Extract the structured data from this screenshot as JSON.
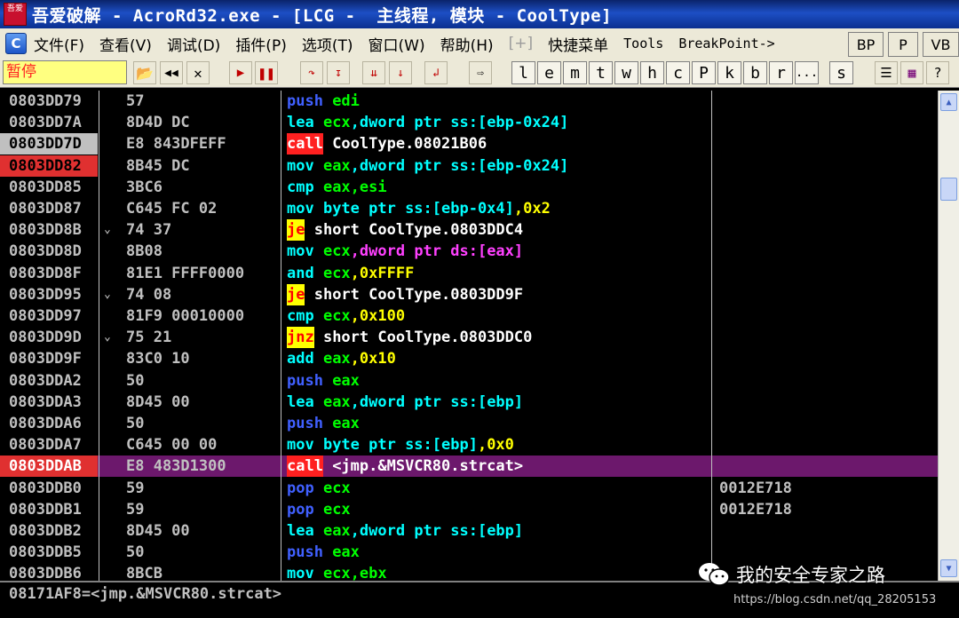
{
  "window": {
    "title": "吾爱破解 - AcroRd32.exe - [LCG -  主线程, 模块 - CoolType]",
    "icon_text": "吾爱"
  },
  "menu": {
    "items": [
      {
        "label": "文件(F)"
      },
      {
        "label": "查看(V)"
      },
      {
        "label": "调试(D)"
      },
      {
        "label": "插件(P)"
      },
      {
        "label": "选项(T)"
      },
      {
        "label": "窗口(W)"
      },
      {
        "label": "帮助(H)"
      },
      {
        "label": "[+]",
        "disabled": true
      },
      {
        "label": "快捷菜单"
      },
      {
        "label": "Tools",
        "mono": true
      },
      {
        "label": "BreakPoint->",
        "mono": true
      }
    ],
    "right_buttons": [
      "BP",
      "P",
      "VB"
    ]
  },
  "toolbar": {
    "status": "暂停",
    "letters": [
      "l",
      "e",
      "m",
      "t",
      "w",
      "h",
      "c",
      "P",
      "k",
      "b",
      "r",
      "...",
      "s"
    ]
  },
  "disasm": {
    "rows": [
      {
        "addr": "0803DD79",
        "mark": "",
        "hex": "57",
        "mnem": "push",
        "ops": [
          {
            "t": " edi",
            "c": "#00ff00"
          }
        ],
        "comment": ""
      },
      {
        "addr": "0803DD7A",
        "mark": "",
        "hex": "8D4D DC",
        "mnem": "lea",
        "ops": [
          {
            "t": " ecx",
            "c": "#00ff00"
          },
          {
            "t": ",dword ptr ss:[ebp-0x24]",
            "c": "#00ffff"
          }
        ],
        "comment": ""
      },
      {
        "addr": "0803DD7D",
        "mark": "",
        "hex": "E8 843DFEFF",
        "mnem": "call",
        "ops": [
          {
            "t": " CoolType.08021B06",
            "c": "#ffffff"
          }
        ],
        "comment": "",
        "addr_style": "eip"
      },
      {
        "addr": "0803DD82",
        "mark": "",
        "hex": "8B45 DC",
        "mnem": "mov",
        "ops": [
          {
            "t": " eax",
            "c": "#00ff00"
          },
          {
            "t": ",dword ptr ss:[ebp-0x24]",
            "c": "#00ffff"
          }
        ],
        "comment": "",
        "addr_style": "bp"
      },
      {
        "addr": "0803DD85",
        "mark": "",
        "hex": "3BC6",
        "mnem": "cmp",
        "ops": [
          {
            "t": " eax,esi",
            "c": "#00ff00"
          }
        ],
        "comment": ""
      },
      {
        "addr": "0803DD87",
        "mark": "",
        "hex": "C645 FC 02",
        "mnem": "mov",
        "ops": [
          {
            "t": " byte ptr ss:[ebp-0x4]",
            "c": "#00ffff"
          },
          {
            "t": ",0x2",
            "c": "#ffff00"
          }
        ],
        "comment": ""
      },
      {
        "addr": "0803DD8B",
        "mark": "⌄",
        "hex": "74 37",
        "mnem": "je",
        "ops": [
          {
            "t": " short CoolType.0803DDC4",
            "c": "#ffffff"
          }
        ],
        "comment": ""
      },
      {
        "addr": "0803DD8D",
        "mark": "",
        "hex": "8B08",
        "mnem": "mov",
        "ops": [
          {
            "t": " ecx",
            "c": "#00ff00"
          },
          {
            "t": ",dword ptr ds:[eax]",
            "c": "#ff40ff"
          }
        ],
        "comment": ""
      },
      {
        "addr": "0803DD8F",
        "mark": "",
        "hex": "81E1 FFFF0000",
        "mnem": "and",
        "ops": [
          {
            "t": " ecx",
            "c": "#00ff00"
          },
          {
            "t": ",0xFFFF",
            "c": "#ffff00"
          }
        ],
        "comment": ""
      },
      {
        "addr": "0803DD95",
        "mark": "⌄",
        "hex": "74 08",
        "mnem": "je",
        "ops": [
          {
            "t": " short CoolType.0803DD9F",
            "c": "#ffffff"
          }
        ],
        "comment": ""
      },
      {
        "addr": "0803DD97",
        "mark": "",
        "hex": "81F9 00010000",
        "mnem": "cmp",
        "ops": [
          {
            "t": " ecx",
            "c": "#00ff00"
          },
          {
            "t": ",0x100",
            "c": "#ffff00"
          }
        ],
        "comment": ""
      },
      {
        "addr": "0803DD9D",
        "mark": "⌄",
        "hex": "75 21",
        "mnem": "jnz",
        "ops": [
          {
            "t": " short CoolType.0803DDC0",
            "c": "#ffffff"
          }
        ],
        "comment": ""
      },
      {
        "addr": "0803DD9F",
        "mark": "",
        "hex": "83C0 10",
        "mnem": "add",
        "ops": [
          {
            "t": " eax",
            "c": "#00ff00"
          },
          {
            "t": ",0x10",
            "c": "#ffff00"
          }
        ],
        "comment": ""
      },
      {
        "addr": "0803DDA2",
        "mark": "",
        "hex": "50",
        "mnem": "push",
        "ops": [
          {
            "t": " eax",
            "c": "#00ff00"
          }
        ],
        "comment": ""
      },
      {
        "addr": "0803DDA3",
        "mark": "",
        "hex": "8D45 00",
        "mnem": "lea",
        "ops": [
          {
            "t": " eax",
            "c": "#00ff00"
          },
          {
            "t": ",dword ptr ss:[ebp]",
            "c": "#00ffff"
          }
        ],
        "comment": ""
      },
      {
        "addr": "0803DDA6",
        "mark": "",
        "hex": "50",
        "mnem": "push",
        "ops": [
          {
            "t": " eax",
            "c": "#00ff00"
          }
        ],
        "comment": ""
      },
      {
        "addr": "0803DDA7",
        "mark": "",
        "hex": "C645 00 00",
        "mnem": "mov",
        "ops": [
          {
            "t": " byte ptr ss:[ebp]",
            "c": "#00ffff"
          },
          {
            "t": ",0x0",
            "c": "#ffff00"
          }
        ],
        "comment": ""
      },
      {
        "addr": "0803DDAB",
        "mark": "",
        "hex": "E8 483D1300",
        "mnem": "call",
        "ops": [
          {
            "t": " <jmp.&MSVCR80.strcat>",
            "c": "#ffffff"
          }
        ],
        "comment": "",
        "selected": true
      },
      {
        "addr": "0803DDB0",
        "mark": "",
        "hex": "59",
        "mnem": "pop",
        "ops": [
          {
            "t": " ecx",
            "c": "#00ff00"
          }
        ],
        "comment": "0012E718"
      },
      {
        "addr": "0803DDB1",
        "mark": "",
        "hex": "59",
        "mnem": "pop",
        "ops": [
          {
            "t": " ecx",
            "c": "#00ff00"
          }
        ],
        "comment": "0012E718"
      },
      {
        "addr": "0803DDB2",
        "mark": "",
        "hex": "8D45 00",
        "mnem": "lea",
        "ops": [
          {
            "t": " eax",
            "c": "#00ff00"
          },
          {
            "t": ",dword ptr ss:[ebp]",
            "c": "#00ffff"
          }
        ],
        "comment": ""
      },
      {
        "addr": "0803DDB5",
        "mark": "",
        "hex": "50",
        "mnem": "push",
        "ops": [
          {
            "t": " eax",
            "c": "#00ff00"
          }
        ],
        "comment": ""
      },
      {
        "addr": "0803DDB6",
        "mark": "",
        "hex": "8BCB",
        "mnem": "mov",
        "ops": [
          {
            "t": " ecx,ebx",
            "c": "#00ff00"
          }
        ],
        "comment": ""
      }
    ]
  },
  "mnemonic_styles": {
    "push": {
      "color": "#4060ff",
      "bg": ""
    },
    "pop": {
      "color": "#4060ff",
      "bg": ""
    },
    "lea": {
      "color": "#00ffff",
      "bg": ""
    },
    "mov": {
      "color": "#00ffff",
      "bg": ""
    },
    "cmp": {
      "color": "#00ffff",
      "bg": ""
    },
    "and": {
      "color": "#00ffff",
      "bg": ""
    },
    "add": {
      "color": "#00ffff",
      "bg": ""
    },
    "call": {
      "color": "#ffffff",
      "bg": "#ff2020"
    },
    "je": {
      "color": "#ff0000",
      "bg": "#ffff00"
    },
    "jnz": {
      "color": "#ff0000",
      "bg": "#ffff00"
    }
  },
  "colors": {
    "selected_row": "#6c186c",
    "eip_addr_bg": "#c0c0c0",
    "bp_addr_bg": "#e03030"
  },
  "info_line": "08171AF8=<jmp.&MSVCR80.strcat>",
  "watermark": {
    "text": "我的安全专家之路",
    "url": "https://blog.csdn.net/qq_28205153"
  }
}
